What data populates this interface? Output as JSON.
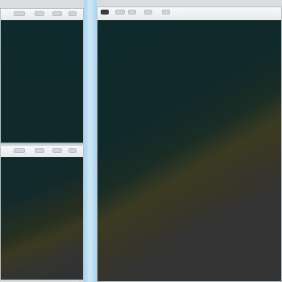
{
  "app": {
    "title": ""
  },
  "panes": {
    "top_left": {
      "name": "viewport-top-left",
      "toolbar": {
        "buttons": [
          "",
          "",
          "",
          ""
        ]
      }
    },
    "bottom_left": {
      "name": "viewport-bottom-left",
      "toolbar": {
        "buttons": [
          "",
          "",
          "",
          ""
        ]
      }
    },
    "main": {
      "name": "viewport-main",
      "toolbar": {
        "buttons": [
          "",
          "",
          "",
          "",
          ""
        ]
      }
    }
  },
  "colors": {
    "background_dark_teal": "#0f2a2c",
    "background_olive": "#3a3a22",
    "background_gray": "#333333",
    "splitter_blue": "#a9d4ee",
    "toolbar_light": "#eef0f2"
  }
}
